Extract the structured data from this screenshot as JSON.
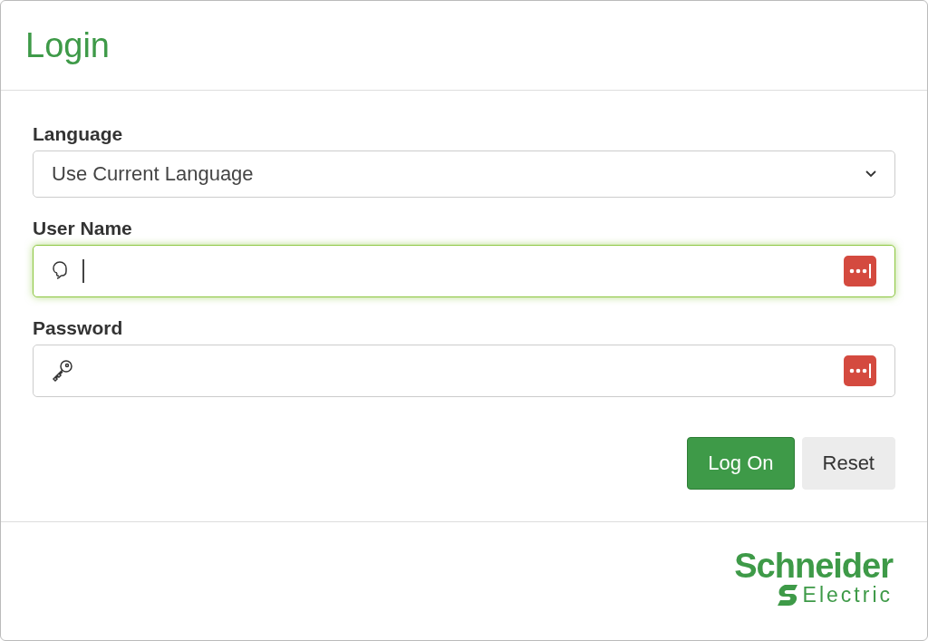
{
  "dialog": {
    "title": "Login"
  },
  "fields": [
    {
      "kind": "select",
      "label": "Language",
      "value": "Use Current Language",
      "focused": false
    },
    {
      "kind": "user",
      "label": "User Name",
      "focused": true
    },
    {
      "kind": "password",
      "label": "Password",
      "focused": false
    }
  ],
  "buttons": [
    {
      "label": "Log On",
      "kind": "primary"
    },
    {
      "label": "Reset",
      "kind": "secondary"
    }
  ],
  "logo": {
    "name": "Schneider",
    "tagline": "Electric"
  }
}
